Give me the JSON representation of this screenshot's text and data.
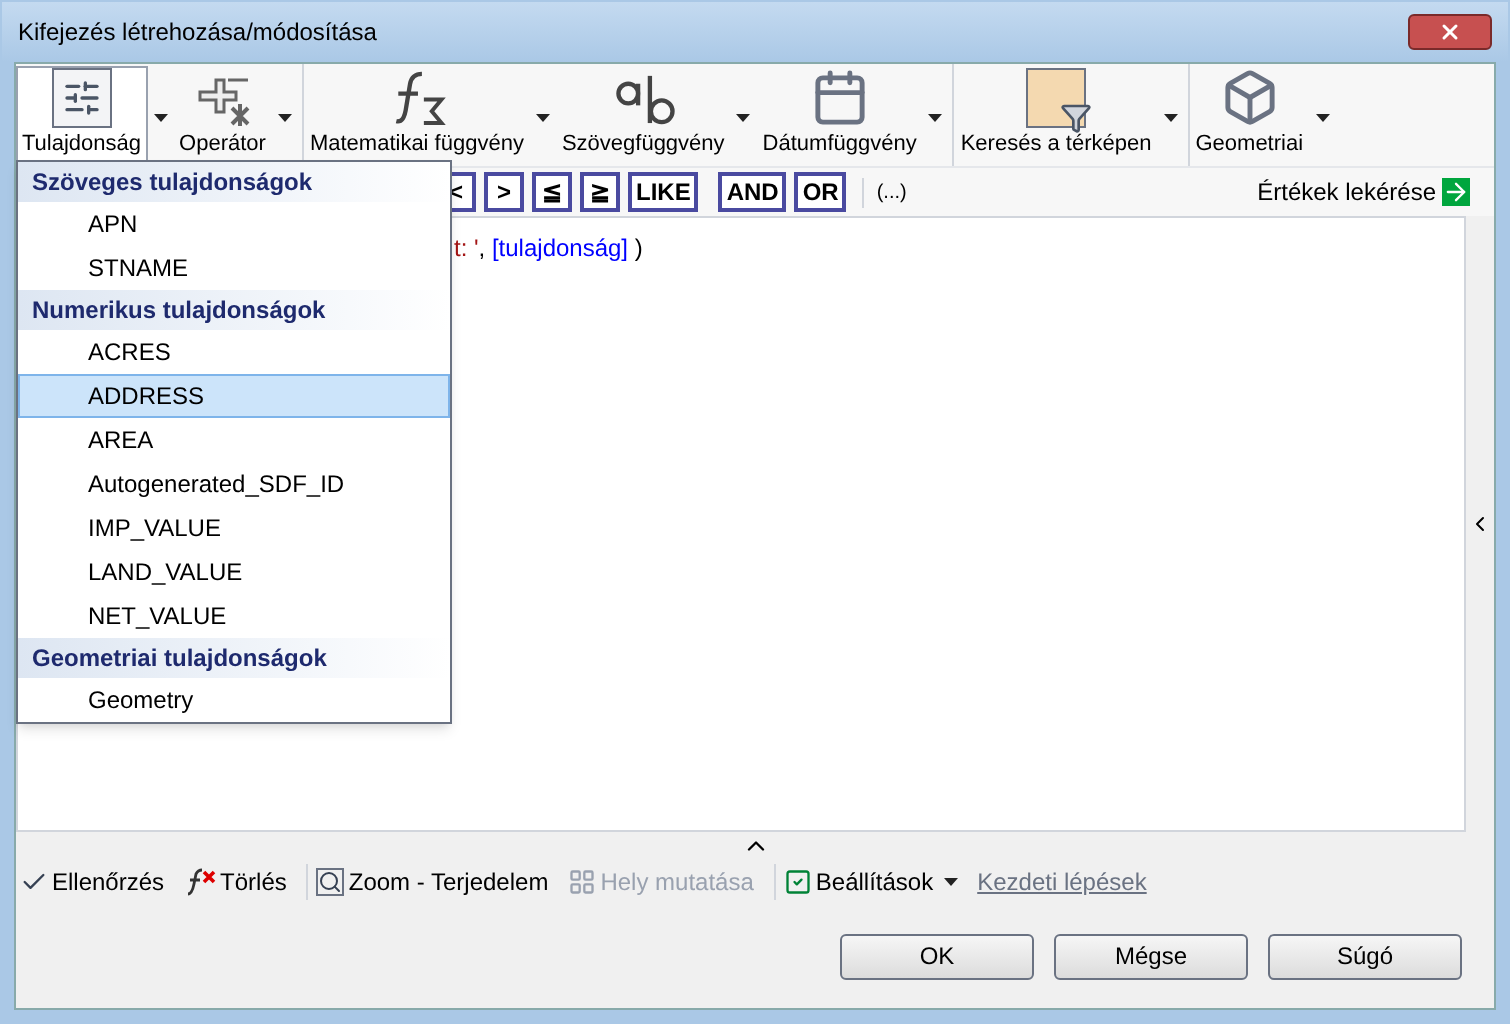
{
  "window": {
    "title": "Kifejezés létrehozása/módosítása"
  },
  "ribbon": [
    {
      "label": "Tulajdonság",
      "kind": "property",
      "selected": true
    },
    {
      "label": "Operátor",
      "kind": "operator",
      "selected": false
    },
    {
      "label": "Matematikai függvény",
      "kind": "math",
      "selected": false
    },
    {
      "label": "Szövegfüggvény",
      "kind": "text",
      "selected": false
    },
    {
      "label": "Dátumfüggvény",
      "kind": "date",
      "selected": false
    },
    {
      "label": "Keresés a térképen",
      "kind": "map",
      "selected": false
    },
    {
      "label": "Geometriai",
      "kind": "geometry",
      "selected": false
    }
  ],
  "operators": [
    "<",
    ">",
    "≦",
    "≧",
    "LIKE",
    "AND",
    "OR",
    "(...)"
  ],
  "get_values": "Értékek lekérése",
  "expression": [
    {
      "text": "t: '",
      "kind": "string"
    },
    {
      "text": ", ",
      "kind": "plain"
    },
    {
      "text": "[tulajdonság]",
      "kind": "property"
    },
    {
      "text": " )",
      "kind": "plain"
    }
  ],
  "property_menu": [
    {
      "heading": "Szöveges tulajdonságok",
      "items": [
        {
          "label": "APN",
          "selected": false
        },
        {
          "label": "STNAME",
          "selected": false
        }
      ]
    },
    {
      "heading": "Numerikus tulajdonságok",
      "items": [
        {
          "label": "ACRES",
          "selected": false
        },
        {
          "label": "ADDRESS",
          "selected": true
        },
        {
          "label": "AREA",
          "selected": false
        },
        {
          "label": "Autogenerated_SDF_ID",
          "selected": false
        },
        {
          "label": "IMP_VALUE",
          "selected": false
        },
        {
          "label": "LAND_VALUE",
          "selected": false
        },
        {
          "label": "NET_VALUE",
          "selected": false
        }
      ]
    },
    {
      "heading": "Geometriai tulajdonságok",
      "items": [
        {
          "label": "Geometry",
          "selected": false
        }
      ]
    }
  ],
  "bottom_toolbar": [
    {
      "label": "Ellenőrzés",
      "kind": "check",
      "disabled": false
    },
    {
      "label": "Törlés",
      "kind": "clear",
      "disabled": false
    },
    {
      "label": "Zoom - Terjedelem",
      "kind": "zoom",
      "disabled": false
    },
    {
      "label": "Hely mutatása",
      "kind": "locate",
      "disabled": true
    },
    {
      "label": "Beállítások",
      "kind": "settings",
      "disabled": false
    },
    {
      "label": "Kezdeti lépések",
      "kind": "link",
      "disabled": false
    }
  ],
  "buttons": [
    "OK",
    "Mégse",
    "Súgó"
  ]
}
